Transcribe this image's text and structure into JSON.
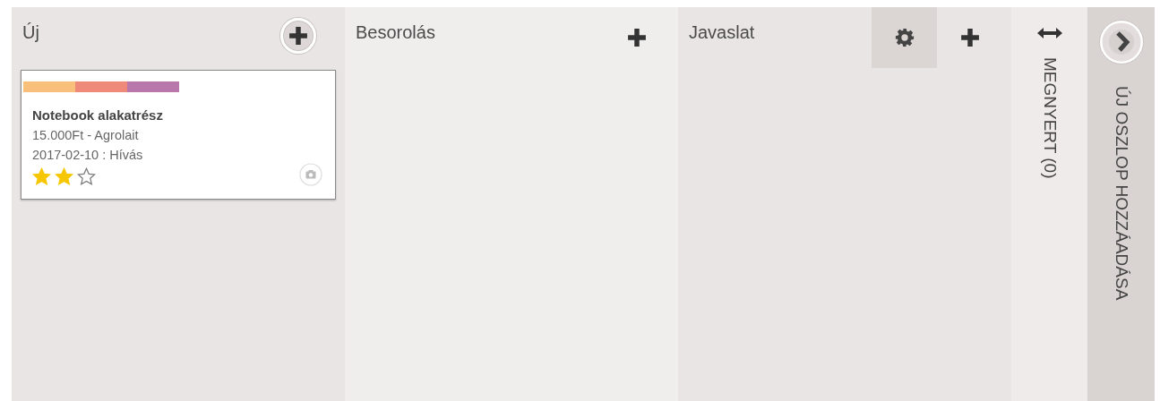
{
  "columns": [
    {
      "kind": "open",
      "title": "Új",
      "add_focused": true,
      "settings_shown": false,
      "cards": [
        {
          "title": "Notebook alakatrész",
          "lines": [
            "15.000Ft - Agrolait",
            "2017-02-10 : Hívás"
          ],
          "tags": [
            {
              "color": "#f9c07c"
            },
            {
              "color": "#ef8979"
            },
            {
              "color": "#b978ac"
            }
          ],
          "stars": 2,
          "has_image": false
        }
      ]
    },
    {
      "kind": "open",
      "title": "Besorolás",
      "add_focused": false,
      "settings_shown": false
    },
    {
      "kind": "open",
      "title": "Javaslat",
      "add_focused": false,
      "settings_shown": true
    },
    {
      "kind": "folded",
      "title": "MEGNYERT (0)"
    },
    {
      "kind": "add",
      "title": "ÚJ OSZLOP HOZZÁADÁSA"
    }
  ]
}
